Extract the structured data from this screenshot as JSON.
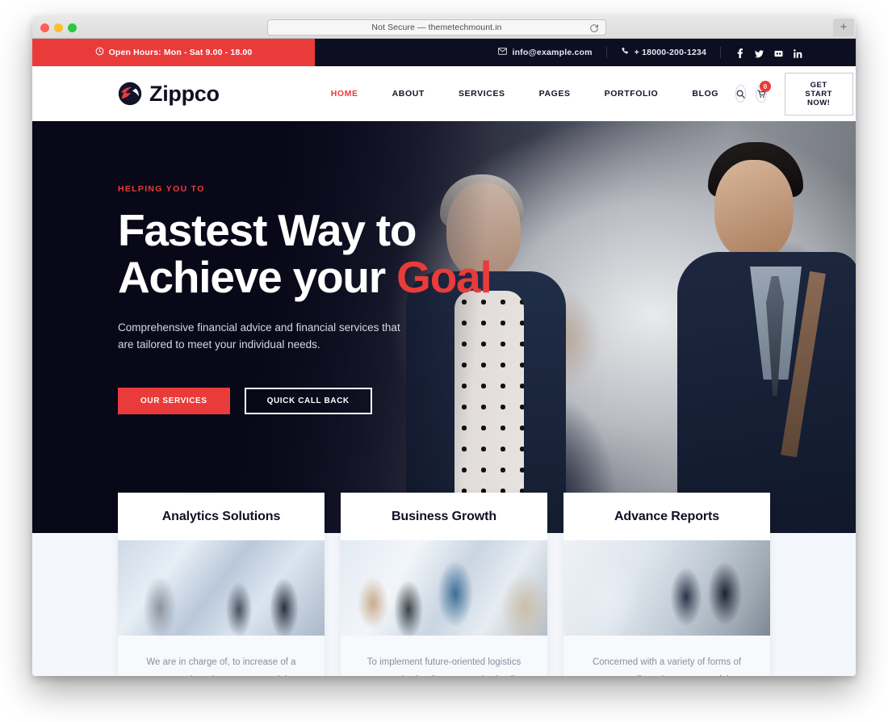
{
  "browser": {
    "url_text": "Not Secure — themetechmount.in",
    "reload_icon": "reload-icon",
    "new_tab_label": "+",
    "traffic_lights": [
      "close",
      "minimize",
      "maximize"
    ]
  },
  "colors": {
    "brand_red": "#ea3b3b",
    "dark_navy": "#0e0e22",
    "body_text": "#8a8fa0",
    "light_section": "#f4f7fb"
  },
  "topbar": {
    "hours_icon": "clock-icon",
    "hours_text": "Open Hours: Mon - Sat 9.00 - 18.00",
    "email_icon": "envelope-icon",
    "email": "info@example.com",
    "phone_icon": "phone-icon",
    "phone": "+ 18000-200-1234",
    "socials": [
      {
        "name": "facebook-icon",
        "label": "f"
      },
      {
        "name": "twitter-icon",
        "label": "t"
      },
      {
        "name": "flickr-icon",
        "label": "fl"
      },
      {
        "name": "linkedin-icon",
        "label": "in"
      }
    ]
  },
  "header": {
    "logo_mark": "zippco-logo-icon",
    "logo_text": "Zippco",
    "nav": [
      {
        "label": "HOME",
        "active": true
      },
      {
        "label": "ABOUT",
        "active": false
      },
      {
        "label": "SERVICES",
        "active": false
      },
      {
        "label": "PAGES",
        "active": false
      },
      {
        "label": "PORTFOLIO",
        "active": false
      },
      {
        "label": "BLOG",
        "active": false
      }
    ],
    "search_icon": "search-icon",
    "cart_icon": "shopping-cart-icon",
    "cart_count": "0",
    "cta_label": "GET START NOW!"
  },
  "hero": {
    "eyebrow": "HELPING YOU TO",
    "title_line1": "Fastest Way to",
    "title_line2_plain": "Achieve your ",
    "title_line2_accent": "Goal",
    "subtitle": "Comprehensive financial advice and financial services that are tailored to meet your individual needs.",
    "btn_primary": "OUR SERVICES",
    "btn_outline": "QUICK CALL BACK",
    "background_image": "two-business-people-walking-and-talking"
  },
  "cards": [
    {
      "title": "Analytics Solutions",
      "text": "We are in charge of, to increase of a consumer brand awareness and the",
      "image": "business-team-handshake-photo"
    },
    {
      "title": "Business Growth",
      "text": "To implement future-oriented logistics strategies leading companies in all",
      "image": "office-meeting-discussion-photo"
    },
    {
      "title": "Advance Reports",
      "text": "Concerned with a variety of forms of company financing, aspects of the",
      "image": "two-businessmen-at-monitor-photo"
    }
  ]
}
